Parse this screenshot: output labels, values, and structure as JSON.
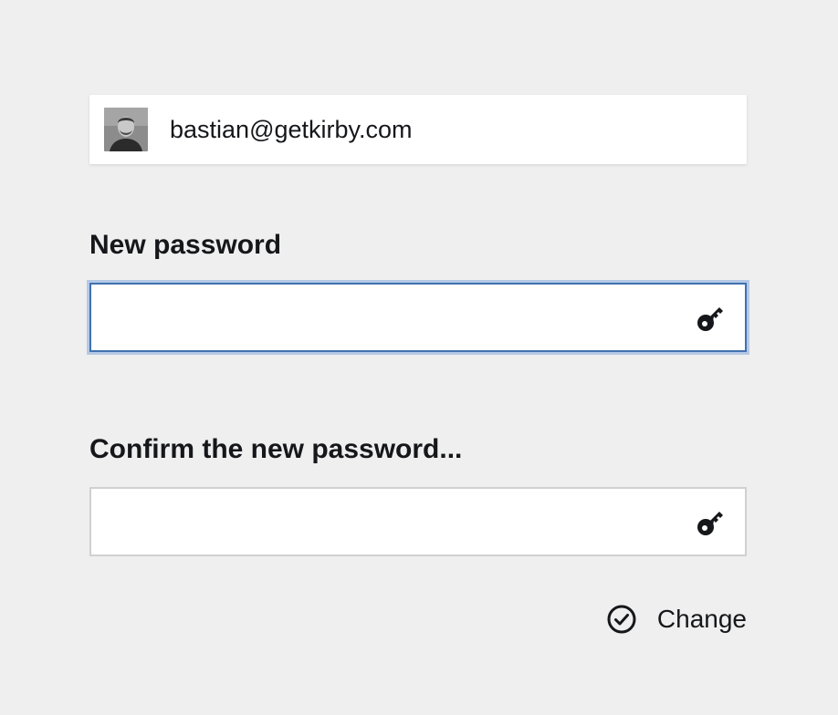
{
  "user": {
    "email": "bastian@getkirby.com",
    "avatar_icon": "user-avatar-photo"
  },
  "form": {
    "new_password": {
      "label": "New password",
      "value": "",
      "icon": "key-icon"
    },
    "confirm_password": {
      "label": "Confirm the new password...",
      "value": "",
      "icon": "key-icon"
    }
  },
  "actions": {
    "change_label": "Change",
    "change_icon": "check-circle-icon"
  },
  "colors": {
    "background": "#efefef",
    "focus_border": "#4271ae",
    "focus_ring": "#b5c9e6",
    "input_border": "#cfd0d1",
    "text": "#16171a"
  }
}
